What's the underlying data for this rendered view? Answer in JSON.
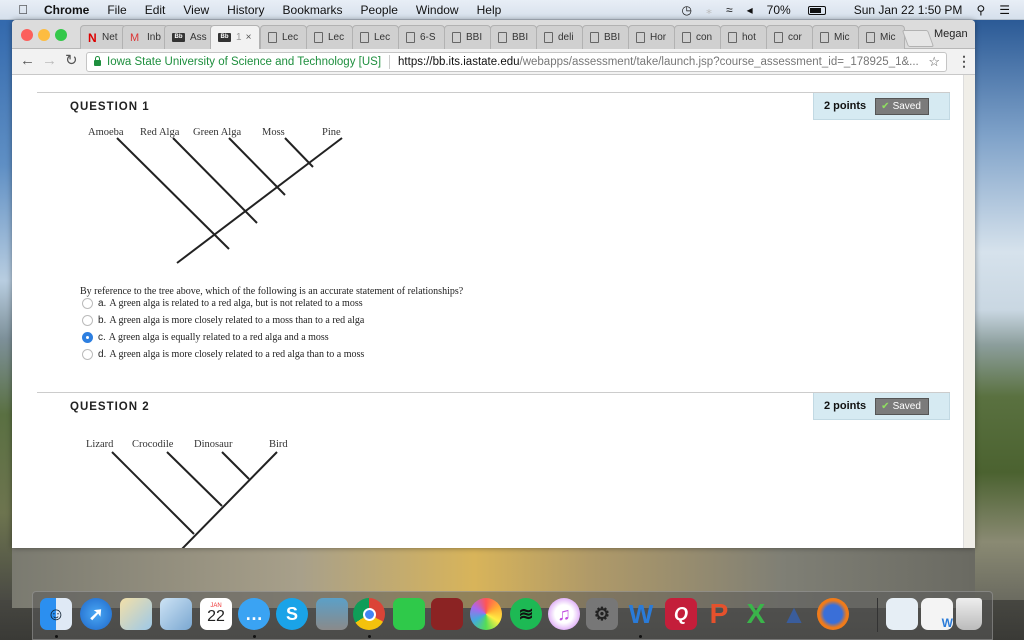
{
  "menubar": {
    "app_name": "Chrome",
    "items": [
      "File",
      "Edit",
      "View",
      "History",
      "Bookmarks",
      "People",
      "Window",
      "Help"
    ],
    "status": {
      "battery": "70%",
      "datetime": "Sun Jan 22  1:50 PM"
    }
  },
  "browser": {
    "tabs": [
      {
        "label": "Net",
        "icon": "netflix-icon"
      },
      {
        "label": "Inb",
        "icon": "gmail-icon"
      },
      {
        "label": "Ass",
        "icon": "blackboard-icon"
      },
      {
        "label": "1",
        "icon": "blackboard-icon",
        "active": true
      },
      {
        "label": "Lec",
        "icon": "page-icon"
      },
      {
        "label": "Lec",
        "icon": "page-icon"
      },
      {
        "label": "Lec",
        "icon": "page-icon"
      },
      {
        "label": "6-S",
        "icon": "page-icon"
      },
      {
        "label": "BBI",
        "icon": "page-icon"
      },
      {
        "label": "BBI",
        "icon": "page-icon"
      },
      {
        "label": "deli",
        "icon": "page-icon"
      },
      {
        "label": "BBI",
        "icon": "page-icon"
      },
      {
        "label": "Hor",
        "icon": "page-icon"
      },
      {
        "label": "con",
        "icon": "page-icon"
      },
      {
        "label": "hot",
        "icon": "page-icon"
      },
      {
        "label": "cor",
        "icon": "page-icon"
      },
      {
        "label": "Mic",
        "icon": "page-icon"
      },
      {
        "label": "Mic",
        "icon": "page-icon"
      }
    ],
    "profile_name": "Megan",
    "address": {
      "org": "Iowa State University of Science and Technology [US]",
      "scheme": "https://",
      "host": "bb.its.iastate.edu",
      "path": "/webapps/assessment/take/launch.jsp?course_assessment_id=_178925_1&..."
    }
  },
  "questions": [
    {
      "title": "QUESTION 1",
      "points": "2 points",
      "status": "Saved",
      "tree_labels": [
        "Amoeba",
        "Red Alga",
        "Green Alga",
        "Moss",
        "Pine"
      ],
      "prompt": "By reference to the tree above, which of the following is an accurate statement of relationships?",
      "options": [
        {
          "letter": "a.",
          "text": "A green alga is related to a red alga, but is not related to a moss",
          "selected": false
        },
        {
          "letter": "b.",
          "text": "A green alga is more closely related to a moss than to a red alga",
          "selected": false
        },
        {
          "letter": "c.",
          "text": "A green alga is equally related to a red alga and a moss",
          "selected": true
        },
        {
          "letter": "d.",
          "text": "A green alga is more closely related to a red alga than to a moss",
          "selected": false
        }
      ]
    },
    {
      "title": "QUESTION 2",
      "points": "2 points",
      "status": "Saved",
      "tree_labels": [
        "Lizard",
        "Crocodile",
        "Dinosaur",
        "Bird"
      ]
    }
  ],
  "dock": {
    "apps": [
      "Finder",
      "Safari",
      "Maps",
      "Mail",
      "Calendar",
      "Messages",
      "Skype",
      "Image Capture",
      "Chrome",
      "FaceTime",
      "Photo Booth",
      "Photos",
      "Spotify",
      "iTunes",
      "System Preferences",
      "Word",
      "Quicken",
      "PowerPoint",
      "Excel",
      "Affinity",
      "Firefox",
      "Documents",
      "Word Document",
      "Trash"
    ],
    "calendar_month": "JAN",
    "calendar_day": "22"
  }
}
